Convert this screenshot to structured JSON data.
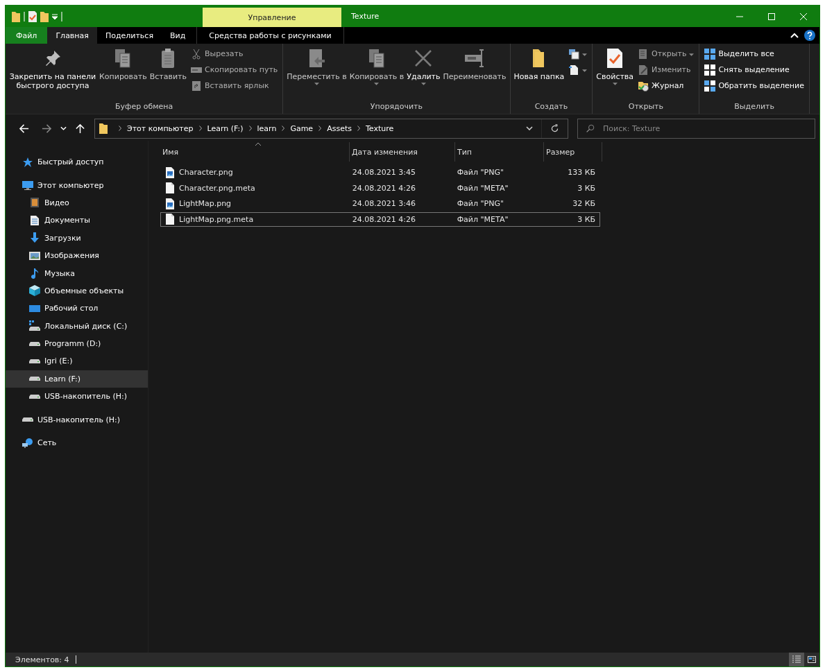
{
  "window": {
    "title": "Texture",
    "context_tab": "Управление"
  },
  "ribbon_tabs": [
    {
      "label": "Файл",
      "kind": "file",
      "selected": false
    },
    {
      "label": "Главная",
      "kind": "tab",
      "selected": true
    },
    {
      "label": "Поделиться",
      "kind": "tab",
      "selected": false
    },
    {
      "label": "Вид",
      "kind": "tab",
      "selected": false
    },
    {
      "label": "Средства работы с рисунками",
      "kind": "contextual",
      "selected": false
    }
  ],
  "ribbon_groups": [
    {
      "title": "Буфер обмена",
      "items": [
        {
          "kind": "pin",
          "label": "Закрепить на панели быстрого доступа",
          "disabled": false,
          "menu": false
        },
        {
          "kind": "copy",
          "label": "Копировать",
          "disabled": true,
          "menu": false
        },
        {
          "kind": "paste",
          "label": "Вставить",
          "disabled": true,
          "menu": false
        },
        {
          "kind": "cut",
          "label": "Вырезать",
          "disabled": true,
          "menu": false
        },
        {
          "kind": "copy-path",
          "label": "Скопировать путь",
          "disabled": true,
          "menu": false
        },
        {
          "kind": "shortcut",
          "label": "Вставить ярлык",
          "disabled": true,
          "menu": false
        }
      ]
    },
    {
      "title": "Упорядочить",
      "items": [
        {
          "kind": "move",
          "label": "Переместить в",
          "disabled": true,
          "menu": true
        },
        {
          "kind": "copy-to",
          "label": "Копировать в",
          "disabled": true,
          "menu": true
        },
        {
          "kind": "delete",
          "label": "Удалить",
          "disabled": false,
          "menu": true
        },
        {
          "kind": "rename",
          "label": "Переименовать",
          "disabled": true,
          "menu": false
        }
      ]
    },
    {
      "title": "Создать",
      "items": [
        {
          "kind": "folder",
          "label": "Новая папка",
          "disabled": false,
          "menu": false
        },
        {
          "kind": "new-item",
          "disabled": false,
          "menu": true
        },
        {
          "kind": "easy-access",
          "disabled": false,
          "menu": true
        }
      ]
    },
    {
      "title": "Открыть",
      "items": [
        {
          "kind": "properties",
          "label": "Свойства",
          "disabled": false,
          "menu": true
        },
        {
          "kind": "open",
          "label": "Открыть",
          "disabled": true,
          "menu": true
        },
        {
          "kind": "edit",
          "label": "Изменить",
          "disabled": true,
          "menu": false
        },
        {
          "kind": "history",
          "label": "Журнал",
          "disabled": false,
          "menu": false
        }
      ]
    },
    {
      "title": "Выделить",
      "items": [
        {
          "kind": "select-all",
          "label": "Выделить все",
          "disabled": false,
          "menu": false
        },
        {
          "kind": "select-none",
          "label": "Снять выделение",
          "disabled": false,
          "menu": false
        },
        {
          "kind": "invert",
          "label": "Обратить выделение",
          "disabled": false,
          "menu": false
        }
      ]
    }
  ],
  "address_bar": {
    "breadcrumb": [
      "Этот компьютер",
      "Learn (F:)",
      "learn",
      "Game",
      "Assets",
      "Texture"
    ]
  },
  "search": {
    "placeholder": "Поиск: Texture"
  },
  "sidebar": {
    "items": [
      {
        "label": "Быстрый доступ",
        "kind": "quick-access",
        "selected": false
      },
      {
        "label": "Этот компьютер",
        "kind": "computer",
        "selected": false,
        "children": [
          {
            "label": "Видео",
            "kind": "videos",
            "selected": false
          },
          {
            "label": "Документы",
            "kind": "documents",
            "selected": false
          },
          {
            "label": "Загрузки",
            "kind": "downloads",
            "selected": false
          },
          {
            "label": "Изображения",
            "kind": "pictures",
            "selected": false
          },
          {
            "label": "Музыка",
            "kind": "music",
            "selected": false
          },
          {
            "label": "Объемные объекты",
            "kind": "objects",
            "selected": false
          },
          {
            "label": "Рабочий стол",
            "kind": "desktop",
            "selected": false
          },
          {
            "label": "Локальный диск (C:)",
            "kind": "system-drive",
            "selected": false
          },
          {
            "label": "Programm (D:)",
            "kind": "drive",
            "selected": false
          },
          {
            "label": "Igri (E:)",
            "kind": "drive",
            "selected": false
          },
          {
            "label": "Learn (F:)",
            "kind": "drive",
            "selected": true
          },
          {
            "label": "USB-накопитель (H:)",
            "kind": "drive",
            "selected": false
          }
        ]
      },
      {
        "label": "USB-накопитель (H:)",
        "kind": "drive",
        "selected": false
      },
      {
        "label": "Сеть",
        "kind": "network",
        "selected": false
      }
    ]
  },
  "table": {
    "columns": [
      {
        "label": "Имя",
        "sorted": true
      },
      {
        "label": "Дата изменения",
        "sorted": false
      },
      {
        "label": "Тип",
        "sorted": false
      },
      {
        "label": "Размер",
        "sorted": false
      }
    ],
    "rows": [
      {
        "kind": "image",
        "name": "Character.png",
        "modified": "24.08.2021 3:45",
        "type": "Файл \"PNG\"",
        "size": "133 КБ",
        "focused": false
      },
      {
        "kind": "file",
        "name": "Character.png.meta",
        "modified": "24.08.2021 4:26",
        "type": "Файл \"META\"",
        "size": "3 КБ",
        "focused": false
      },
      {
        "kind": "image",
        "name": "LightMap.png",
        "modified": "24.08.2021 3:46",
        "type": "Файл \"PNG\"",
        "size": "32 КБ",
        "focused": false
      },
      {
        "kind": "file",
        "name": "LightMap.png.meta",
        "modified": "24.08.2021 4:26",
        "type": "Файл \"META\"",
        "size": "3 КБ",
        "focused": true
      }
    ]
  },
  "status_bar": {
    "text": "Элементов: 4",
    "views": [
      {
        "kind": "details",
        "selected": true
      },
      {
        "kind": "tiles",
        "selected": false
      }
    ]
  }
}
